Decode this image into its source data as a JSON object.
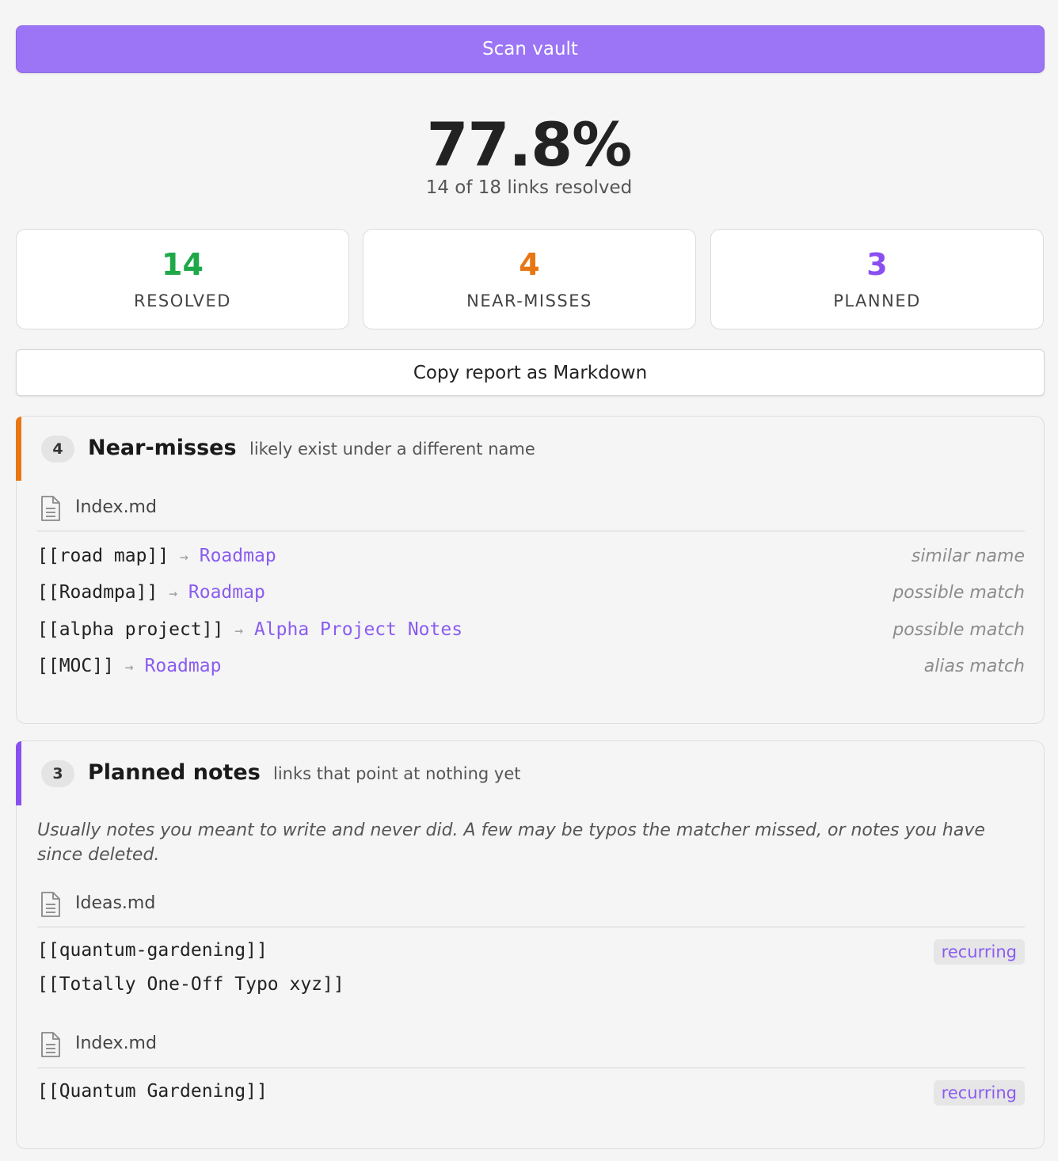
{
  "scan_button": "Scan vault",
  "summary": {
    "percent": "77.8%",
    "subtitle": "14 of 18 links resolved"
  },
  "stats": [
    {
      "value": "14",
      "label": "RESOLVED",
      "color": "#1fa84a"
    },
    {
      "value": "4",
      "label": "NEAR-MISSES",
      "color": "#e87612"
    },
    {
      "value": "3",
      "label": "PLANNED",
      "color": "#8a4ff0"
    }
  ],
  "copy_button": "Copy report as Markdown",
  "near_misses": {
    "count": "4",
    "title": "Near-misses",
    "subtitle": "likely exist under a different name",
    "accent": "#e87612",
    "file": "Index.md",
    "items": [
      {
        "link": "[[road map]]",
        "arrow": "→",
        "target": "Roadmap",
        "reason": "similar name"
      },
      {
        "link": "[[Roadmpa]]",
        "arrow": "→",
        "target": "Roadmap",
        "reason": "possible match"
      },
      {
        "link": "[[alpha project]]",
        "arrow": "→",
        "target": "Alpha Project Notes",
        "reason": "possible match"
      },
      {
        "link": "[[MOC]]",
        "arrow": "→",
        "target": "Roadmap",
        "reason": "alias match"
      }
    ]
  },
  "planned": {
    "count": "3",
    "title": "Planned notes",
    "subtitle": "links that point at nothing yet",
    "accent": "#8a4ff0",
    "note": "Usually notes you meant to write and never did. A few may be typos the matcher missed, or notes you have since deleted.",
    "groups": [
      {
        "file": "Ideas.md",
        "items": [
          {
            "link": "[[quantum-gardening]]",
            "tag": "recurring"
          },
          {
            "link": "[[Totally One-Off Typo xyz]]",
            "tag": ""
          }
        ]
      },
      {
        "file": "Index.md",
        "items": [
          {
            "link": "[[Quantum Gardening]]",
            "tag": "recurring"
          }
        ]
      }
    ]
  }
}
